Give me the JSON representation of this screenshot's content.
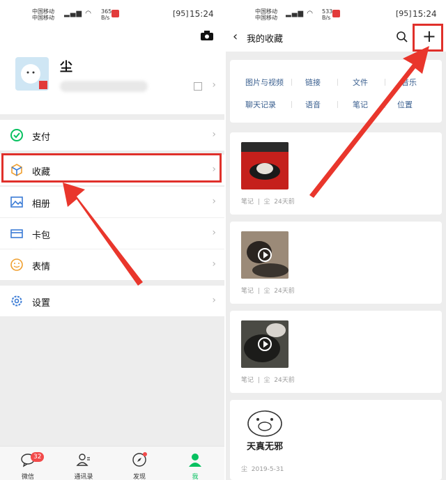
{
  "status": {
    "carrier_line1": "中国移动",
    "carrier_line2": "中国移动",
    "speed_line1": "365",
    "speed_line2": "B/s",
    "speed_line1_right": "533",
    "speed_line2_right": "B/s",
    "battery": "95",
    "time": "15:24"
  },
  "profile": {
    "name": "尘"
  },
  "menu": [
    {
      "label": "支付",
      "icon": "payment-icon"
    },
    {
      "label": "收藏",
      "icon": "favorites-icon"
    },
    {
      "label": "相册",
      "icon": "album-icon"
    },
    {
      "label": "卡包",
      "icon": "card-wallet-icon"
    },
    {
      "label": "表情",
      "icon": "emoji-icon"
    },
    {
      "label": "设置",
      "icon": "settings-icon"
    }
  ],
  "tabbar": {
    "items": [
      "微信",
      "通讯录",
      "发现",
      "我"
    ],
    "badge": "32"
  },
  "favorites": {
    "title": "我的收藏",
    "categories_row1": [
      "图片与视频",
      "链接",
      "文件",
      "音乐"
    ],
    "categories_row2": [
      "聊天记录",
      "语音",
      "笔记",
      "位置"
    ],
    "items": [
      {
        "type": "笔记",
        "sep": "|",
        "author": "尘",
        "time": "24天前"
      },
      {
        "type": "笔记",
        "sep": "|",
        "author": "尘",
        "time": "24天前"
      },
      {
        "type": "笔记",
        "sep": "|",
        "author": "尘",
        "time": "24天前"
      },
      {
        "author": "尘",
        "time": "2019-5-31",
        "caption": "天真无邪"
      }
    ]
  },
  "colors": {
    "accent_green": "#07c160",
    "highlight_red": "#e0302a",
    "link_blue": "#3a5f8f"
  }
}
